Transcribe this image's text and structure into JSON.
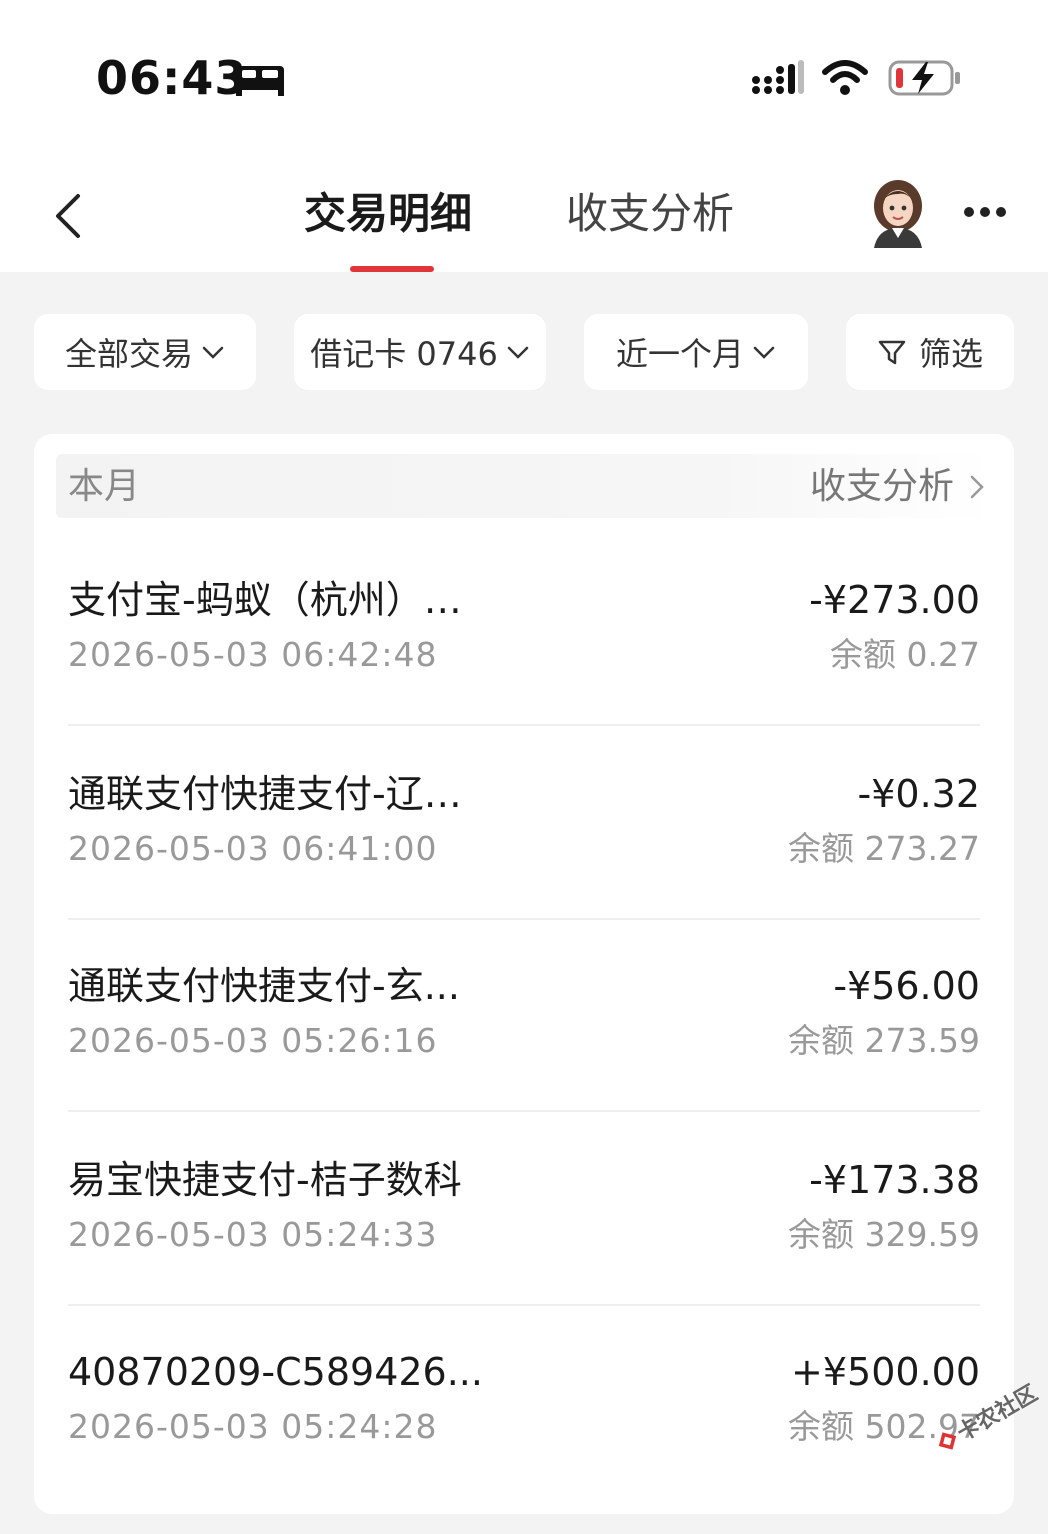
{
  "status_bar": {
    "time": "06:43",
    "icons": [
      "bed-icon",
      "signal-icon",
      "wifi-icon",
      "battery-charging-icon"
    ],
    "battery_color": "#e0353b"
  },
  "header": {
    "tabs": [
      {
        "label": "交易明细",
        "active": true
      },
      {
        "label": "收支分析",
        "active": false
      }
    ],
    "accent_color": "#e0353b"
  },
  "filters": [
    {
      "label": "全部交易"
    },
    {
      "label": "借记卡 0746"
    },
    {
      "label": "近一个月"
    },
    {
      "label": "筛选"
    }
  ],
  "list": {
    "period_label": "本月",
    "analysis_link": "收支分析",
    "transactions": [
      {
        "title": "支付宝-蚂蚁（杭州）…",
        "time": "2026-05-03 06:42:48",
        "amount": "-¥273.00",
        "balance": "余额 0.27"
      },
      {
        "title": "通联支付快捷支付-辽…",
        "time": "2026-05-03 06:41:00",
        "amount": "-¥0.32",
        "balance": "余额 273.27"
      },
      {
        "title": "通联支付快捷支付-玄...",
        "time": "2026-05-03 05:26:16",
        "amount": "-¥56.00",
        "balance": "余额 273.59"
      },
      {
        "title": "易宝快捷支付-桔子数科",
        "time": "2026-05-03 05:24:33",
        "amount": "-¥173.38",
        "balance": "余额 329.59"
      },
      {
        "title": "40870209-C589426...",
        "time": "2026-05-03 05:24:28",
        "amount": "+¥500.00",
        "balance": "余额 502.97"
      }
    ]
  },
  "watermark": {
    "text": "卡农社区"
  }
}
